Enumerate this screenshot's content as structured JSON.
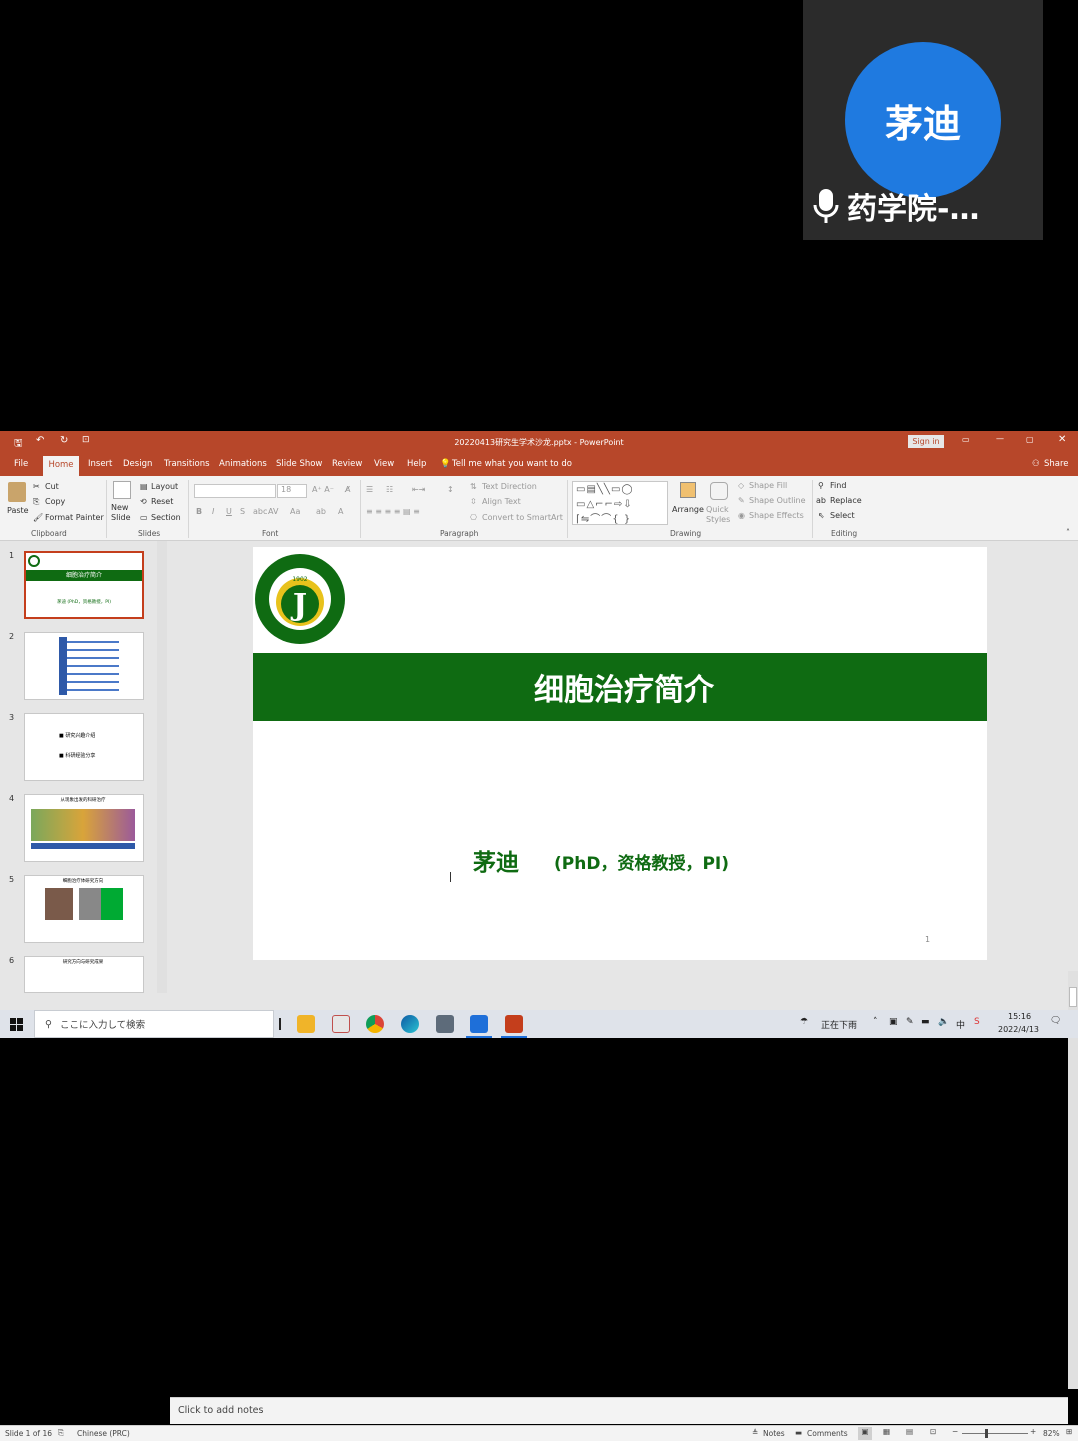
{
  "participant": {
    "avatar_text": "茅迪",
    "name": "药学院-…",
    "mic_icon": "microphone-icon"
  },
  "window": {
    "doc_title": "20220413研究生学术沙龙.pptx - PowerPoint",
    "signin": "Sign in",
    "accent": "#b7472a"
  },
  "tabs": [
    "File",
    "Home",
    "Insert",
    "Design",
    "Transitions",
    "Animations",
    "Slide Show",
    "Review",
    "View",
    "Help"
  ],
  "tell_me": "Tell me what you want to do",
  "share": "Share",
  "ribbon": {
    "paste": "Paste",
    "cut": "Cut",
    "copy": "Copy",
    "format_painter": "Format Painter",
    "clipboard": "Clipboard",
    "new_slide": "New\nSlide",
    "layout": "Layout",
    "reset": "Reset",
    "section": "Section",
    "slides": "Slides",
    "font_size": "18",
    "font": "Font",
    "text_direction": "Text Direction",
    "align_text": "Align Text",
    "convert_smartart": "Convert to SmartArt",
    "paragraph": "Paragraph",
    "arrange": "Arrange",
    "quick_styles": "Quick\nStyles",
    "shape_fill": "Shape Fill",
    "shape_outline": "Shape Outline",
    "shape_effects": "Shape Effects",
    "drawing": "Drawing",
    "find": "Find",
    "replace": "Replace",
    "select": "Select",
    "editing": "Editing"
  },
  "thumbnails": [
    {
      "num": "1",
      "title": "细胞治疗简介",
      "sub": "茅迪 (PhD，资格教授，PI)"
    },
    {
      "num": "2"
    },
    {
      "num": "3",
      "line1": "■ 研究兴趣介绍",
      "line2": "■ 科研经验分享"
    },
    {
      "num": "4",
      "title": "从现象出发的科研治疗"
    },
    {
      "num": "5",
      "title": "细胞治疗体研究方向"
    },
    {
      "num": "6",
      "title": "研究方向与研究成果"
    }
  ],
  "slide": {
    "title": "细胞治疗简介",
    "author": "茅迪",
    "author_sub": "(PhD，资格教授，PI)",
    "number": "1",
    "logo_year": "1902",
    "logo_letter": "J",
    "green": "#0f6b12"
  },
  "notes_placeholder": "Click to add notes",
  "status": {
    "slide_of": "Slide 1 of 16",
    "language": "Chinese (PRC)",
    "notes": "Notes",
    "comments": "Comments",
    "zoom": "82%"
  },
  "taskbar": {
    "search_placeholder": "ここに入力して検索",
    "weather": "正在下雨",
    "ime": "中",
    "time": "15:16",
    "date": "2022/4/13"
  }
}
